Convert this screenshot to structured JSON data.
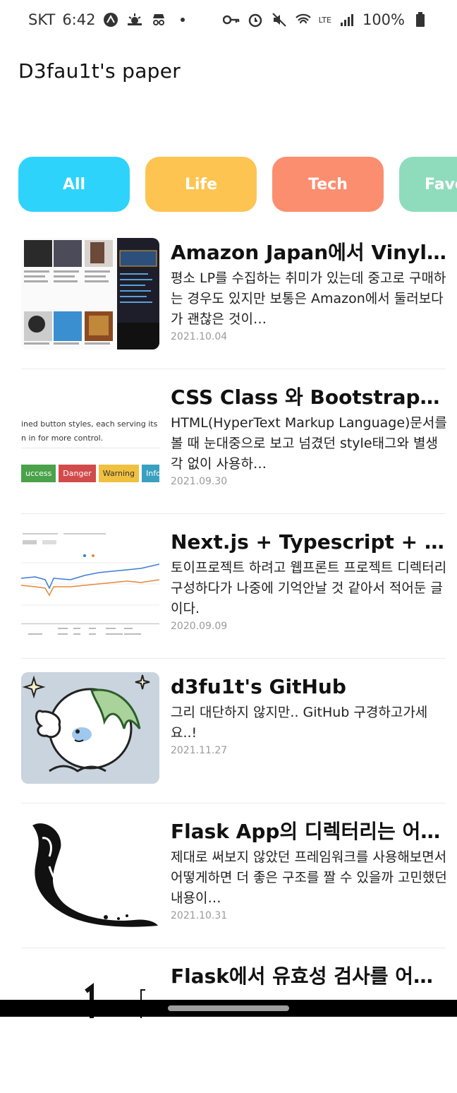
{
  "status_bar": {
    "carrier": "SKT",
    "time": "6:42",
    "lte": "LTE",
    "battery": "100%"
  },
  "app": {
    "title": "D3fau1t's paper"
  },
  "categories": [
    {
      "label": "All",
      "color": "#2ed3fb"
    },
    {
      "label": "Life",
      "color": "#fdc451"
    },
    {
      "label": "Tech",
      "color": "#fb8e6f"
    },
    {
      "label": "Favo",
      "color": "#8fdcbd"
    }
  ],
  "posts": [
    {
      "title": "Amazon Japan에서 Vinyl 상…",
      "desc": "평소 LP를 수집하는 취미가 있는데 중고로 구매하는 경우도 있지만 보통은 Amazon에서 둘러보다가 괜찮은 것이…",
      "date": "2021.10.04"
    },
    {
      "title": "CSS Class 와 Bootstrap이…",
      "desc": "HTML(HyperText Markup Language)문서를 볼 때 눈대중으로 보고 넘겼던 style태그와 별생각 없이 사용하…",
      "date": "2021.09.30",
      "thumb_text": {
        "line1": "ined button styles, each serving its own",
        "line2": "n in for more control.",
        "buttons": [
          "uccess",
          "Danger",
          "Warning",
          "Info"
        ]
      }
    },
    {
      "title": "Next.js + Typescript + Tail..",
      "desc": "토이프로젝트 하려고 웹프론트 프로젝트 디렉터리 구성하다가 나중에 기억안날 것 같아서 적어둔 글이다.",
      "date": "2020.09.09"
    },
    {
      "title": "d3fu1t's GitHub",
      "desc": "그리 대단하지 않지만.. GitHub 구경하고가세요..!",
      "date": "2021.11.27"
    },
    {
      "title": "Flask App의 디렉터리는 어떤…",
      "desc": "제대로 써보지 않았던 프레임워크를 사용해보면서 어떻게하면 더 좋은 구조를 짤 수 있을까 고민했던 내용이…",
      "date": "2021.10.31"
    },
    {
      "title": "Flask에서 유효성 검사를 어떻…",
      "desc": "",
      "date": ""
    }
  ]
}
